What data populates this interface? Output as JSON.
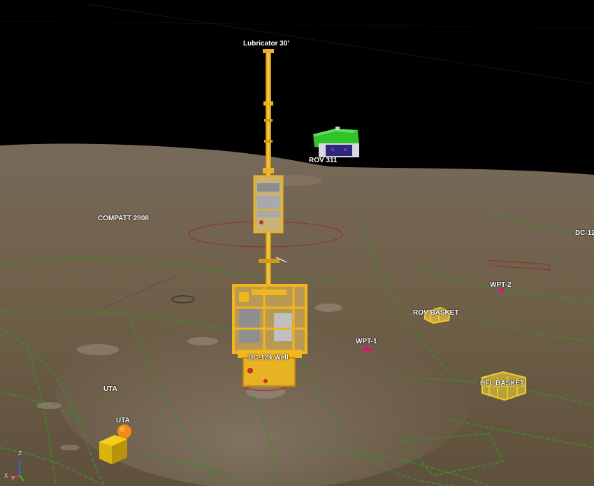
{
  "scene": {
    "sky_color": "#000000",
    "seabed_color": "#7a6a55",
    "accent_color": "#e8b322",
    "rov_color": "#2fc42a",
    "waypoint_color": "#e0107a",
    "pipeline_color": "#3f8a2b",
    "labels": {
      "lubricator": "Lubricator 30'",
      "rov": "ROV 311",
      "compatt": "COMPATT 2808",
      "dc_partial": "DC-12",
      "wpt2": "WPT-2",
      "rov_basket": "ROV BASKET",
      "wpt1": "WPT-1",
      "well": "DC-124 Well",
      "hfl_basket": "HFL BASKET",
      "uta_upper": "UTA",
      "uta_lower": "UTA"
    }
  },
  "axes": {
    "z": "Z",
    "x": "X",
    "y": "Y"
  }
}
